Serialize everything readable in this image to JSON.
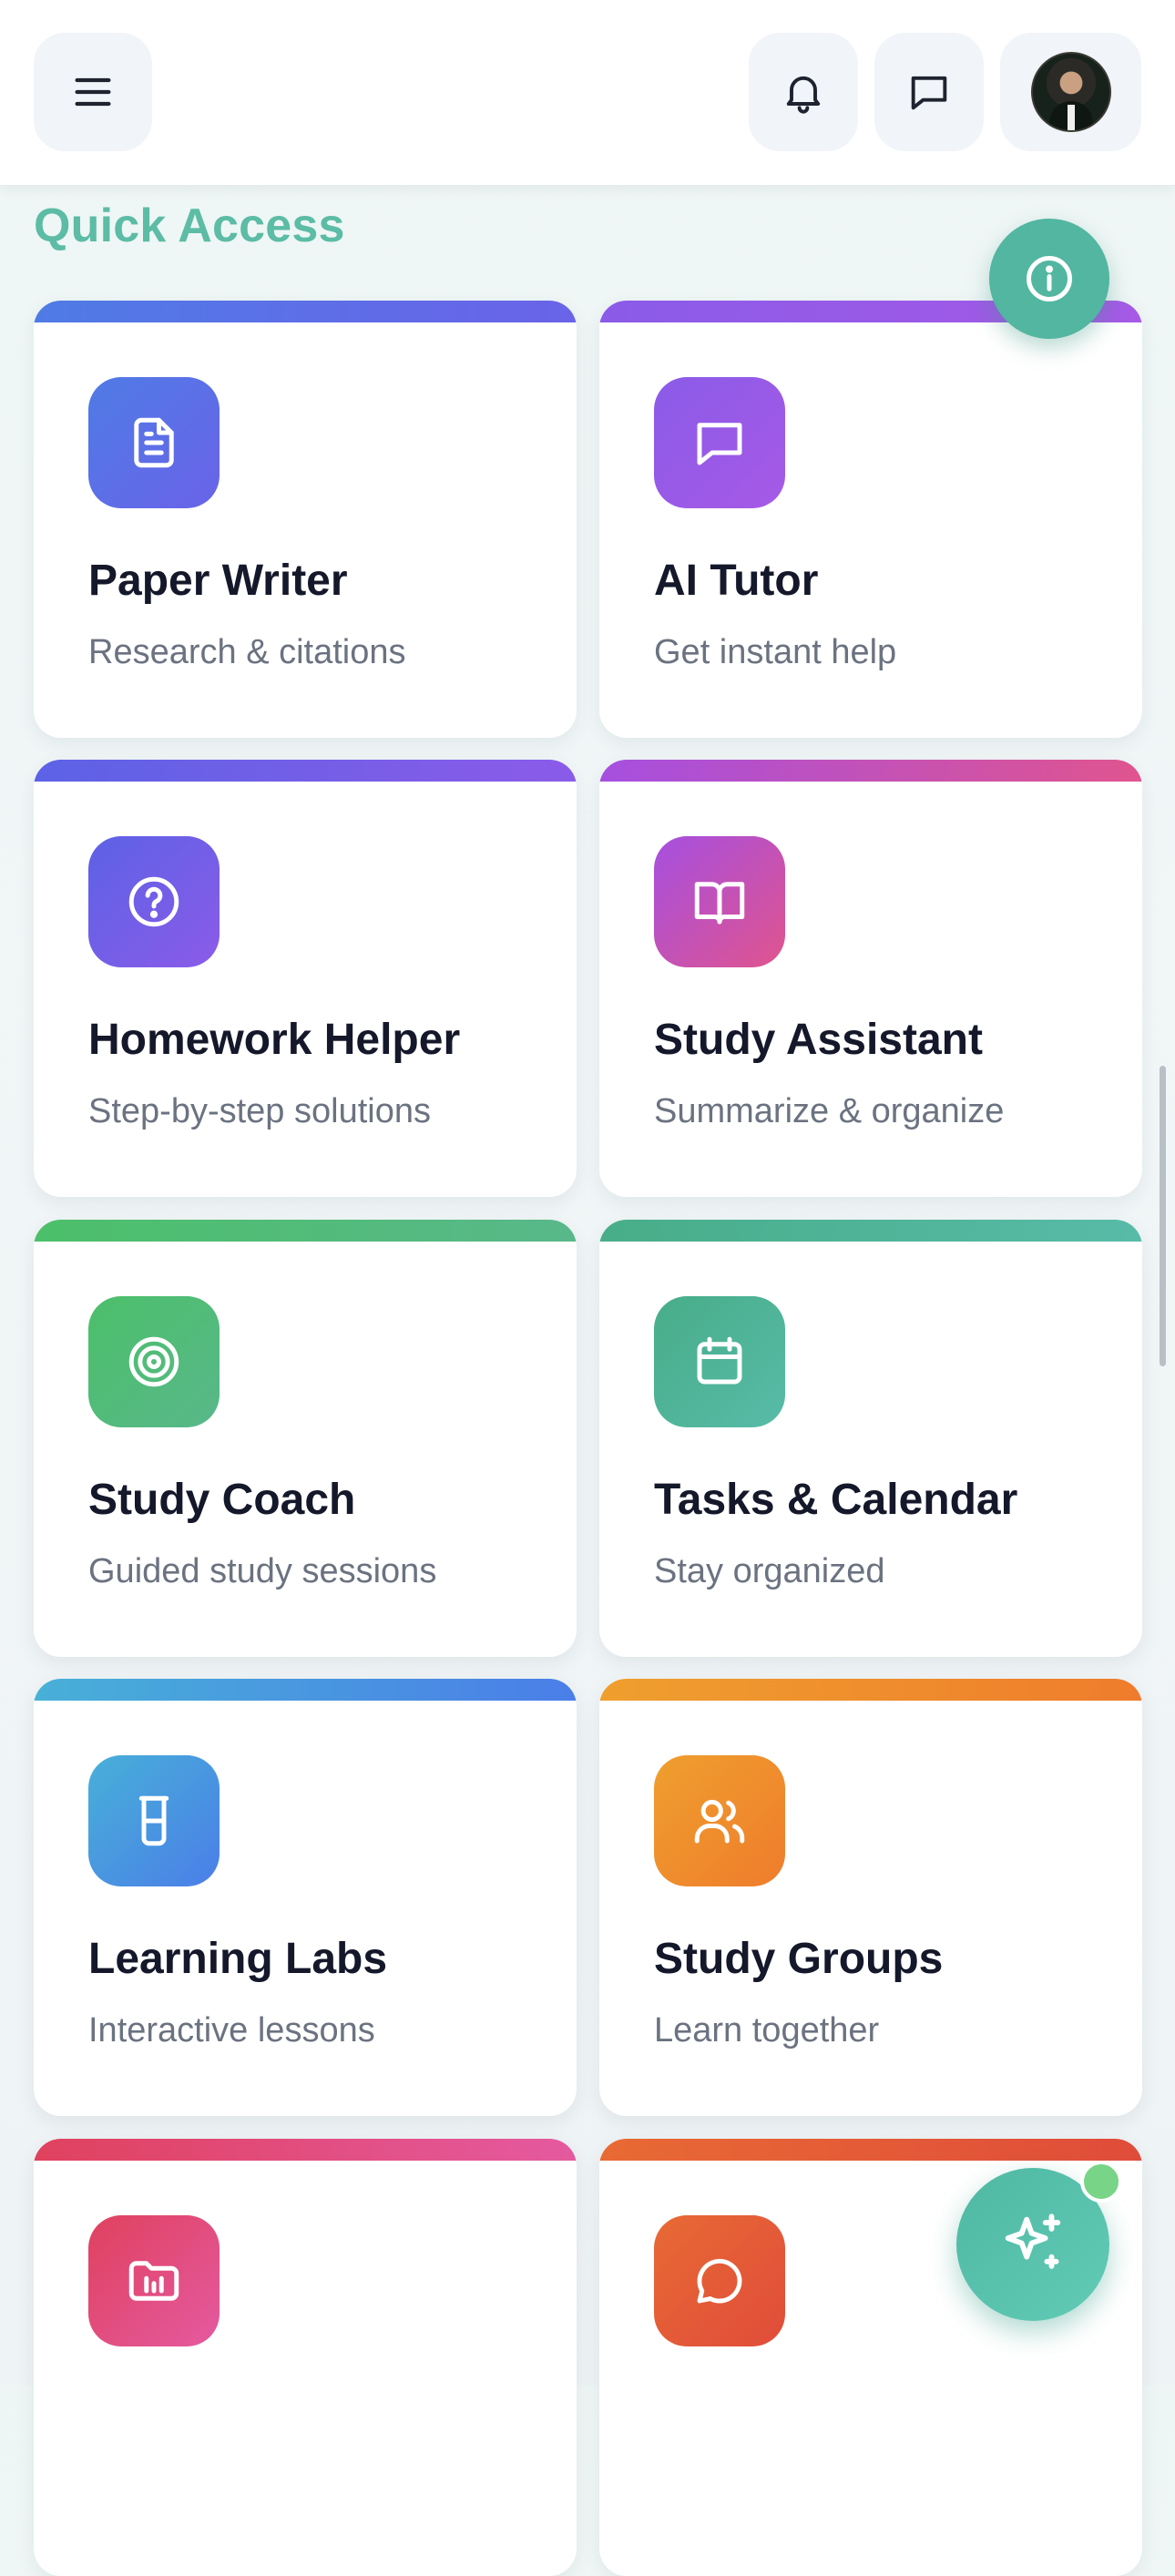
{
  "header": {
    "menu_icon": "hamburger-menu-icon",
    "notifications_icon": "bell-icon",
    "messages_icon": "message-square-icon",
    "avatar_icon": "user-avatar"
  },
  "section": {
    "title": "Quick Access"
  },
  "info_fab": {
    "icon": "info-icon"
  },
  "ai_fab": {
    "icon": "sparkles-icon",
    "badge_color": "#78d487"
  },
  "cards": [
    {
      "title": "Paper Writer",
      "subtitle": "Research & citations",
      "icon": "file-text-icon",
      "color_from": "#4f7be6",
      "color_to": "#6a63e8"
    },
    {
      "title": "AI Tutor",
      "subtitle": "Get instant help",
      "icon": "message-square-icon",
      "color_from": "#8a5be8",
      "color_to": "#a65ae6"
    },
    {
      "title": "Homework Helper",
      "subtitle": "Step-by-step solutions",
      "icon": "help-circle-icon",
      "color_from": "#5c62e6",
      "color_to": "#8b5be8"
    },
    {
      "title": "Study Assistant",
      "subtitle": "Summarize & organize",
      "icon": "book-open-icon",
      "color_from": "#a64fe0",
      "color_to": "#e0548e"
    },
    {
      "title": "Study Coach",
      "subtitle": "Guided study sessions",
      "icon": "target-icon",
      "color_from": "#4cbf6a",
      "color_to": "#58b88a"
    },
    {
      "title": "Tasks & Calendar",
      "subtitle": "Stay organized",
      "icon": "calendar-icon",
      "color_from": "#48ad88",
      "color_to": "#57bba8"
    },
    {
      "title": "Learning Labs",
      "subtitle": "Interactive lessons",
      "icon": "beaker-icon",
      "color_from": "#48b0d8",
      "color_to": "#4a7ee8"
    },
    {
      "title": "Study Groups",
      "subtitle": "Learn together",
      "icon": "users-icon",
      "color_from": "#ef9f2e",
      "color_to": "#ef7c2c"
    },
    {
      "title": "",
      "subtitle": "",
      "icon": "folder-chart-icon",
      "color_from": "#e0415e",
      "color_to": "#e45aa0"
    },
    {
      "title": "",
      "subtitle": "",
      "icon": "message-circle-icon",
      "color_from": "#e86a34",
      "color_to": "#e04c3a"
    }
  ]
}
